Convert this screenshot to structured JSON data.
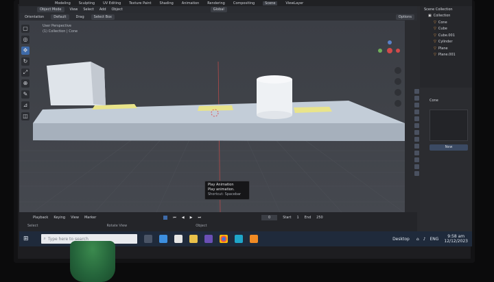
{
  "topbar": {
    "menus": [
      "Modeling",
      "Sculpting",
      "UV Editing",
      "Texture Paint",
      "Shading",
      "Animation",
      "Rendering",
      "Compositing"
    ],
    "scene": "Scene",
    "view_layer": "ViewLayer"
  },
  "header2": {
    "mode": "Object Mode",
    "view": "View",
    "select": "Select",
    "add": "Add",
    "object": "Object",
    "orientation": "Global"
  },
  "header3": {
    "orientation_label": "Orientation",
    "default": "Default",
    "drag": "Drag",
    "select_box": "Select Box",
    "options": "Options"
  },
  "viewport": {
    "line1": "User Perspective",
    "line2": "(1) Collection | Cone"
  },
  "outliner": {
    "title": "Scene Collection",
    "items": [
      "Collection",
      "Cone",
      "Cube",
      "Cube.001",
      "Cylinder",
      "Plane",
      "Plane.001"
    ]
  },
  "properties": {
    "object_name": "Cone",
    "new_label": "New"
  },
  "timeline": {
    "playback": "Playback",
    "keying": "Keying",
    "view": "View",
    "marker": "Marker",
    "current_frame": "0",
    "start_label": "Start",
    "start_value": "1",
    "end_label": "End",
    "end_value": "250",
    "select": "Select",
    "rotate_view": "Rotate View",
    "object": "Object"
  },
  "tooltip": {
    "title": "Play Animation",
    "desc": "Play animation.",
    "shortcut": "Shortcut: Spacebar"
  },
  "taskbar": {
    "search_placeholder": "Type here to search",
    "desktop": "Desktop",
    "lang": "ENG",
    "time": "9:58 am",
    "date": "12/12/2023"
  },
  "colors": {
    "accent": "#3e6aa8",
    "taskbar": "#1f2a3b",
    "floor": "#b9c4d0",
    "yellow_plane": "#e9e48a",
    "cup_green": "#2b7a45"
  }
}
